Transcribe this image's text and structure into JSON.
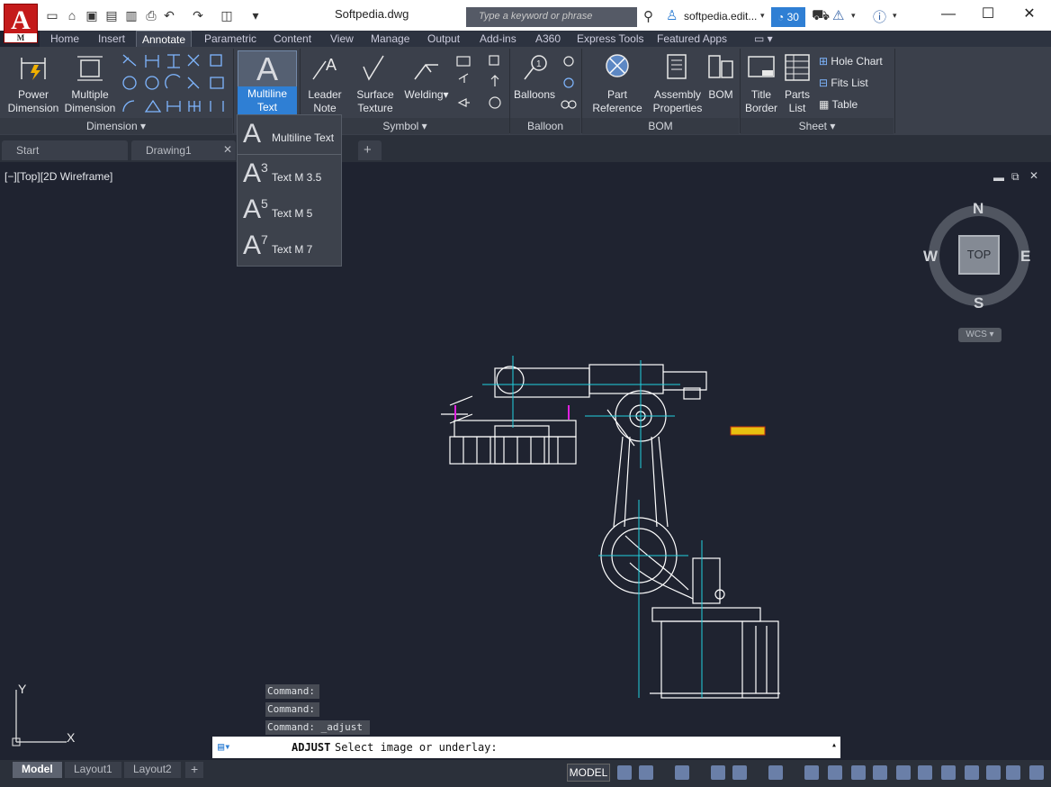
{
  "window": {
    "title": "Softpedia.dwg",
    "search_placeholder": "Type a keyword or phrase",
    "user": "softpedia.edit...",
    "timer": "30",
    "app_badge": "M"
  },
  "tabs": [
    "Home",
    "Insert",
    "Annotate",
    "Parametric",
    "Content",
    "View",
    "Manage",
    "Output",
    "Add-ins",
    "A360",
    "Express Tools",
    "Featured Apps"
  ],
  "ribbon": {
    "dimension": {
      "power_dim": "Power\nDimension",
      "multi_dim": "Multiple\nDimension",
      "title": "Dimension"
    },
    "text": {
      "mtext": "Multiline\nText"
    },
    "symbol": {
      "leader": "Leader\nNote",
      "surface": "Surface\nTexture",
      "welding": "Welding",
      "title": "Symbol"
    },
    "balloon": {
      "balloons": "Balloons",
      "title": "Balloon"
    },
    "bom": {
      "part_ref": "Part\nReference",
      "assembly": "Assembly\nProperties",
      "bom": "BOM",
      "title": "BOM"
    },
    "sheet": {
      "title_border": "Title\nBorder",
      "parts_list": "Parts\nList",
      "hole_chart": "Hole Chart",
      "fits_list": "Fits List",
      "table": "Table",
      "title": "Sheet"
    }
  },
  "dropdown": {
    "items": [
      {
        "glyph": "A",
        "sup": "",
        "label": "Multiline Text"
      },
      {
        "glyph": "A",
        "sup": "3",
        "label": "Text M 3.5"
      },
      {
        "glyph": "A",
        "sup": "5",
        "label": "Text M 5"
      },
      {
        "glyph": "A",
        "sup": "7",
        "label": "Text M 7"
      }
    ]
  },
  "file_tabs": [
    "Start",
    "Drawing1"
  ],
  "viewport": {
    "label": "[−][Top][2D Wireframe]",
    "compass": {
      "n": "N",
      "s": "S",
      "e": "E",
      "w": "W"
    },
    "cube_face": "TOP",
    "wcs": "WCS"
  },
  "ucs": {
    "x": "X",
    "y": "Y"
  },
  "command": {
    "history": [
      "Command:",
      "Command:",
      "Command: _adjust"
    ],
    "prompt_cmd": "ADJUST",
    "prompt_text": "Select image or underlay:"
  },
  "layout_tabs": [
    "Model",
    "Layout1",
    "Layout2"
  ],
  "status": {
    "model": "MODEL"
  },
  "colors": {
    "accent": "#2f7fd4",
    "canvas": "#1f2330",
    "ribbon": "#3b404b",
    "logo": "#c41a1a"
  }
}
